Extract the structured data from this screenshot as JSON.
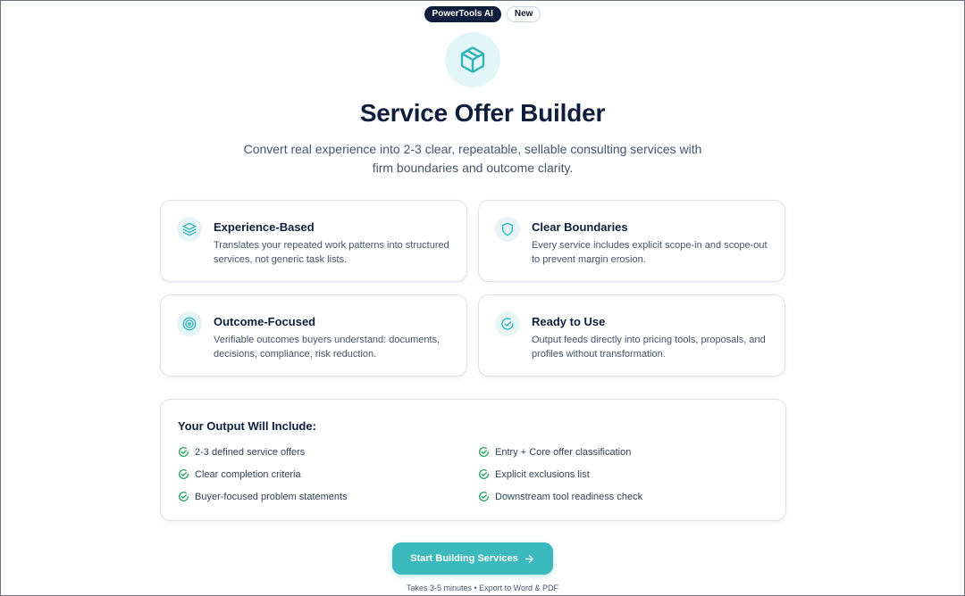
{
  "badges": {
    "brand": "PowerTools AI",
    "new": "New"
  },
  "hero": {
    "icon": "package-box-icon",
    "title": "Service Offer Builder",
    "subtitle": "Convert real experience into 2-3 clear, repeatable, sellable consulting services with firm boundaries and outcome clarity."
  },
  "features": [
    {
      "icon": "layers-icon",
      "title": "Experience-Based",
      "desc": "Translates your repeated work patterns into structured services, not generic task lists."
    },
    {
      "icon": "shield-icon",
      "title": "Clear Boundaries",
      "desc": "Every service includes explicit scope-in and scope-out to prevent margin erosion."
    },
    {
      "icon": "target-icon",
      "title": "Outcome-Focused",
      "desc": "Verifiable outcomes buyers understand: documents, decisions, compliance, risk reduction."
    },
    {
      "icon": "check-circle-icon",
      "title": "Ready to Use",
      "desc": "Output feeds directly into pricing tools, proposals, and profiles without transformation."
    }
  ],
  "output": {
    "heading": "Your Output Will Include:",
    "items": [
      "2-3 defined service offers",
      "Entry + Core offer classification",
      "Clear completion criteria",
      "Explicit exclusions list",
      "Buyer-focused problem statements",
      "Downstream tool readiness check"
    ]
  },
  "cta": {
    "label": "Start Building Services",
    "icon": "arrow-right-icon"
  },
  "footnote": "Takes 3-5 minutes • Export to Word & PDF",
  "colors": {
    "accent": "#3bb9bd",
    "navy": "#0f1e3c",
    "check": "#22a55a"
  }
}
